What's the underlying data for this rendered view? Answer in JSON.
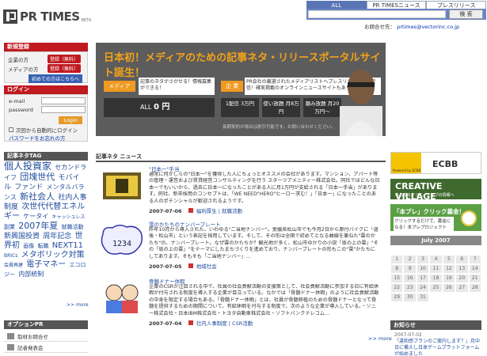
{
  "header": {
    "logo_text": "PR TIMES",
    "logo_beta": "BETA",
    "tabs": [
      "ALL",
      "PR TIMESニュース",
      "プレスリリース"
    ],
    "search_button": "検 索",
    "contact_label": "お問合せ先",
    "contact_email": "prtimes@vectorinc.co.jp"
  },
  "registration": {
    "heading": "新規登録",
    "rows": [
      {
        "label": "企業の方",
        "button": "登録（無料）"
      },
      {
        "label": "メディアの方",
        "button": "登録（無料）"
      }
    ],
    "first_time": "初めての方はこちらへ"
  },
  "login": {
    "heading": "ログイン",
    "email_label": "e-mail",
    "password_label": "password",
    "button": "Login",
    "auto_login": "次回から自動的にログイン",
    "forgot": "パスワードをお忘れの方"
  },
  "tags": {
    "heading": "記事ネタTAG",
    "items": [
      "個人投資家",
      "セカンドライフ",
      "団塊世代",
      "モバイル",
      "ファンド",
      "メンタルバランス",
      "新社会人",
      "社内人事制度",
      "次世代代替エネルギー",
      "ケータイ",
      "キャッシュレス",
      "副業",
      "2007年夏",
      "就職活動",
      "新興国投資",
      "O",
      "周年記念",
      "世界初",
      "画像",
      "転職",
      "NEXT11",
      "BRICs",
      "メタボリック対策",
      "会員再建",
      "電子マネー",
      "エコロジー",
      "内部統制"
    ],
    "more": ">> more"
  },
  "options": {
    "heading": "オプションPR",
    "items": [
      "取材お問合せ",
      "記者発表会"
    ]
  },
  "banner": {
    "title": "日本初！メディアのための記事ネタ・リリースポータルサイト誕生！",
    "media_tag": "メディア",
    "media_desc": "記事のネタがさがせる！情報募集ができる！",
    "free_prefix": "ALL",
    "free_value": "0 円",
    "corp_tag": "企 業",
    "corp_desc": "PR会社の厳選されたメディアリストへプレスリリース一括配信！確実掲載のオンラインニュースサイトもあります！",
    "plans": [
      "1配信 3万円",
      "使い放題 月8万円",
      "頼み放題 月20万円～"
    ],
    "note": "長期契約の場合は割引可能です。お問い合わせください。"
  },
  "news": {
    "heading": "記事ネタ ニュース",
    "items": [
      {
        "title": "\"日本一\"手当",
        "body": "通常に何かしらの\"日本一\"を獲得した人にちょっとオススメの会社があります。マンション、アパート等の管理・運営および賃貸経営コンサルティングを行う スターツアメニティー株式会社。同社ではどんな日本一でもいいから、過去に日本一になったことがある人に月1万円が支給される「日本一手当」があります。同社、新卒採用のコンセプトは、「WE NEED\"HERO\"ヒーロー求む！」「日本一」になったことのある人のポテンシャルが歓迎されるようです。",
        "date": "2007-07-06",
        "categories": "福利厚生 | 就職活動"
      },
      {
        "title": "雲のかたちのナンバープレート",
        "body": "昨年10月から導入された、いわゆる\"ご当地ナンバー\"。愛媛県松山市でも今月2日から原付バイクに「道後・松山市」という表記を採用しています。そして、その形は全国で初めてとなる曲線を兼ねた\"雲のかたち\"の、ナンバープレート。なぜ雲のかたちか？観光地が多く、松山市ゆかりの小説「坂の上の雲」\"その「坂の上の雲」\"をテーマにしたまちづくりを進めており、ナンバープレートの形もこの\"雲\"かたちにしてあります。そもそも「ご当地ナンバー」...",
        "date": "2007-07-05",
        "categories": "地域社会"
      },
      {
        "title": "骨髄ドナー休暇",
        "body": "企業のCSRが注目される中で、社員の社会貢献活動の支援策として、社会貢献活動に参加する日に有給休暇が付与される制度を導入する企業が目立っている。なかでは「骨髄ドナー休暇」のように社会貢献活動の中身を限定する場合もある。「骨髄ドナー休暇」とは、社員が骨髄移植のための骨髄ドナーとなって骨髄を提供するための期間について、有給休暇を付与する制度で、次のような企業が導入している。・ソニー株式会社・日本IBM株式会社・トヨタ自動車株式会社・ソフトバンクテレコム...",
        "date": "2007-07-04",
        "categories": "社内人事制度 | CSR活動"
      }
    ],
    "more": ">> more"
  },
  "right": {
    "ecbb": "ECBB",
    "ecbb_sub": "Powered by ECBB",
    "creative": "CREATIVE VILLAGE",
    "creative_sub": "あらゆるクリエイティブの情報へ",
    "honpre": "「本プレ」クリック募金！",
    "honpre_sub": "クリックするだけで、募金になる！本プレプロジェクト",
    "calendar_title": "July 2007",
    "calendar_rows": [
      [
        "",
        "",
        "",
        "",
        "",
        "",
        ""
      ],
      [
        "1",
        "2",
        "3",
        "4",
        "5",
        "6",
        "7"
      ],
      [
        "8",
        "9",
        "10",
        "11",
        "12",
        "13",
        "14"
      ],
      [
        "15",
        "16",
        "17",
        "18",
        "19",
        "20",
        "21"
      ],
      [
        "22",
        "23",
        "24",
        "25",
        "26",
        "27",
        "28"
      ],
      [
        "29",
        "30",
        "31",
        "",
        "",
        "",
        ""
      ]
    ],
    "info_heading": "お知らせ",
    "info_date": "2007-07-02",
    "info_text": "「違和感ブランのご案内します？」月中日に備えし日本ゲームプラットフォームが始めました"
  }
}
